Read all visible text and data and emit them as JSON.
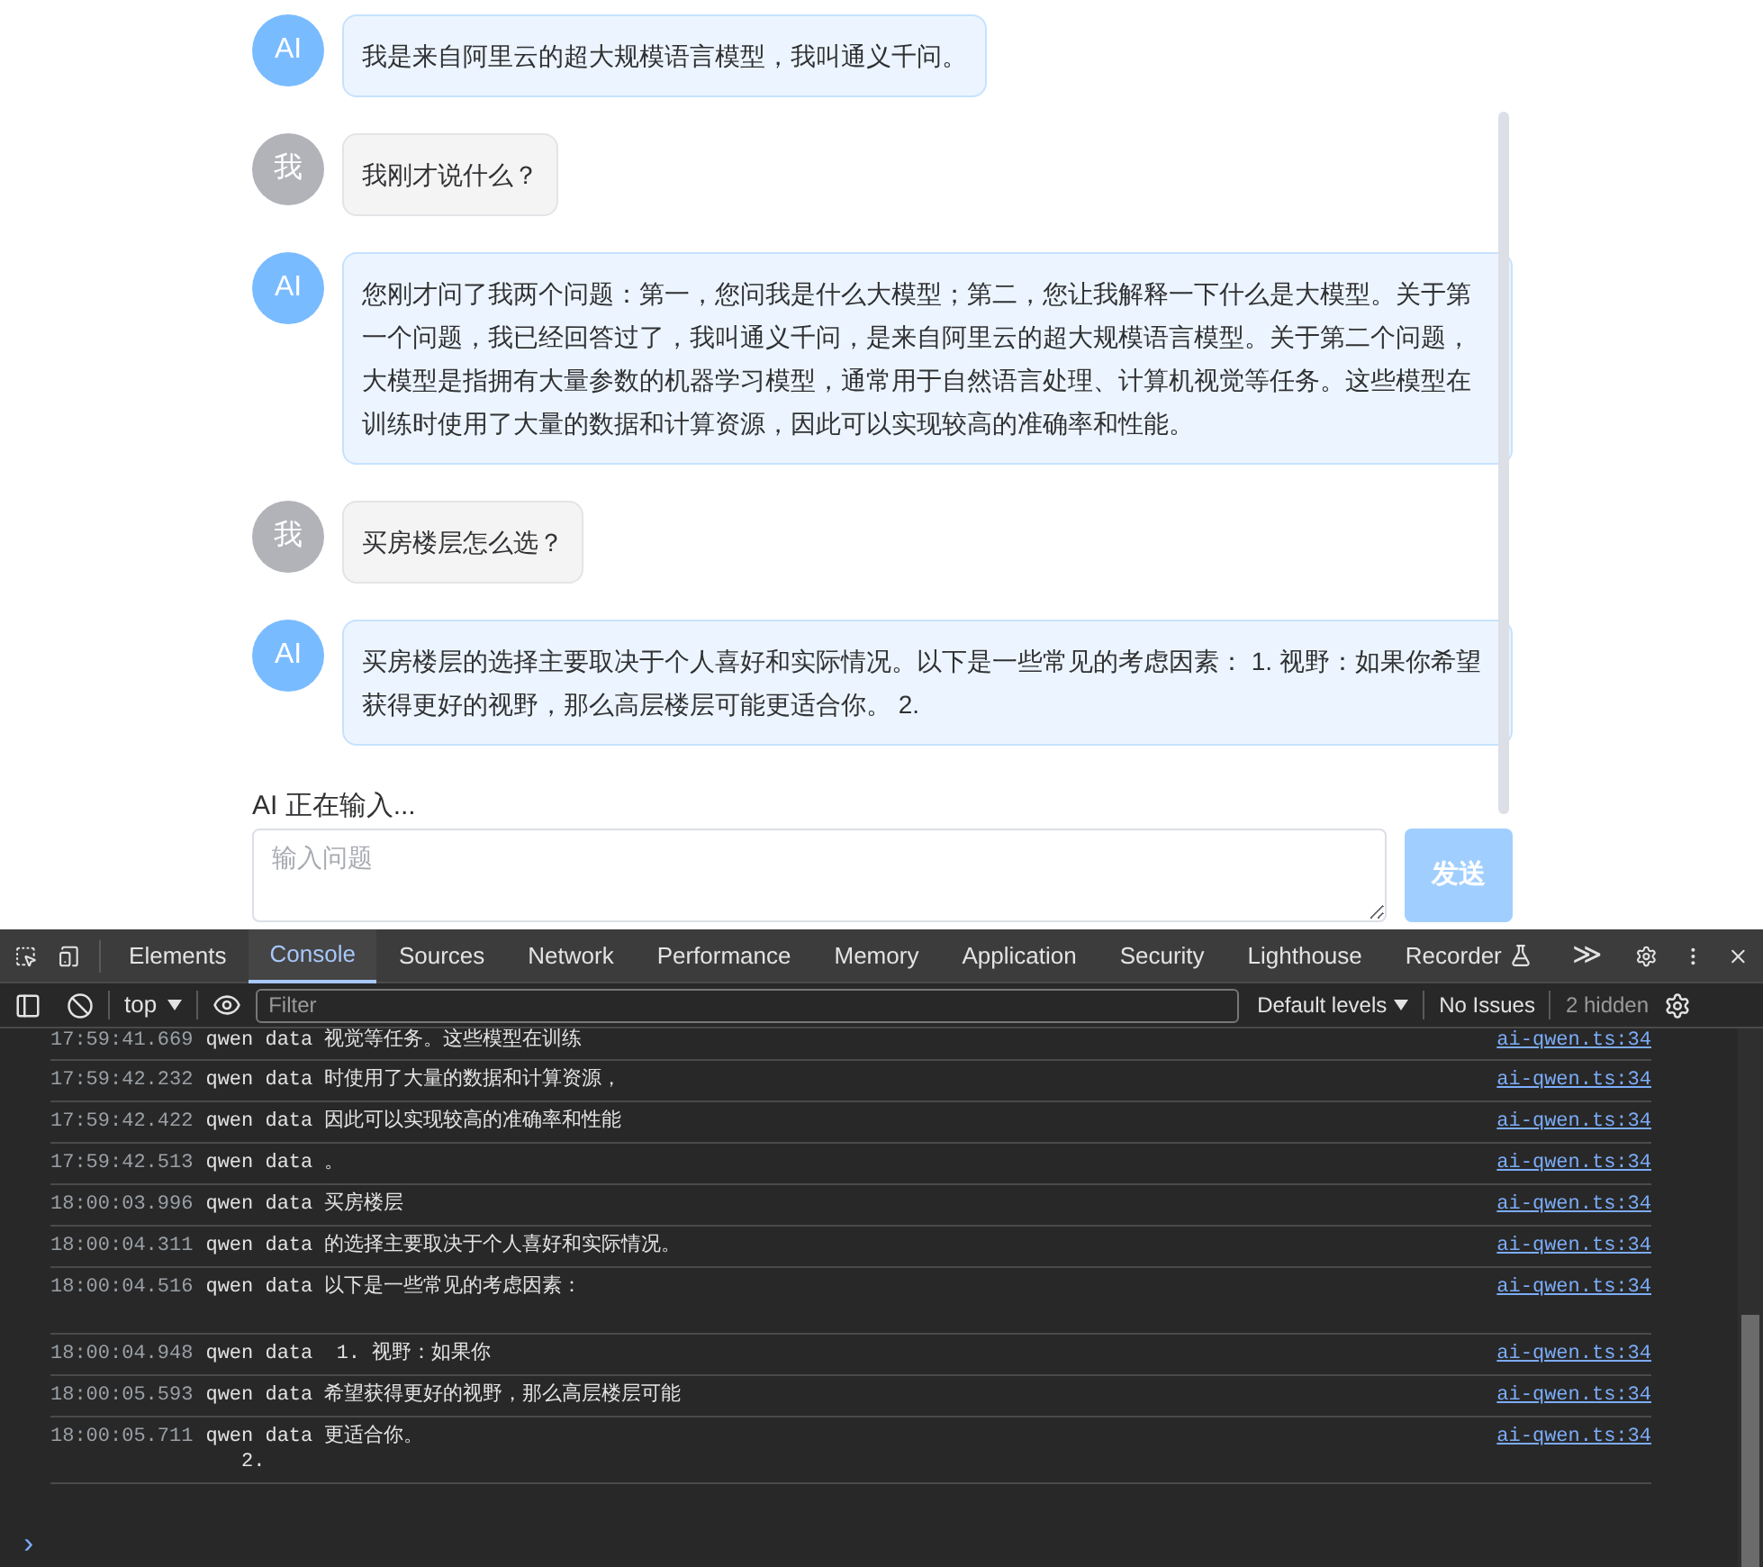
{
  "chat": {
    "messages": [
      {
        "kind": "ai",
        "avatar": "AI",
        "text": "我是来自阿里云的超大规模语言模型，我叫通义千问。"
      },
      {
        "kind": "user",
        "avatar": "我",
        "text": "我刚才说什么？"
      },
      {
        "kind": "ai",
        "avatar": "AI",
        "text": "您刚才问了我两个问题：第一，您问我是什么大模型；第二，您让我解释一下什么是大模型。关于第一个问题，我已经回答过了，我叫通义千问，是来自阿里云的超大规模语言模型。关于第二个问题，大模型是指拥有大量参数的机器学习模型，通常用于自然语言处理、计算机视觉等任务。这些模型在训练时使用了大量的数据和计算资源，因此可以实现较高的准确率和性能。"
      },
      {
        "kind": "user",
        "avatar": "我",
        "text": "买房楼层怎么选？"
      },
      {
        "kind": "ai",
        "avatar": "AI",
        "text": "买房楼层的选择主要取决于个人喜好和实际情况。以下是一些常见的考虑因素： 1. 视野：如果你希望获得更好的视野，那么高层楼层可能更适合你。 2."
      }
    ],
    "status": "AI 正在输入...",
    "input": {
      "placeholder": "输入问题"
    },
    "send_button": {
      "label": "发送",
      "disabled": true
    }
  },
  "devtools": {
    "tabs": [
      {
        "label": "Elements",
        "selected": false
      },
      {
        "label": "Console",
        "selected": true
      },
      {
        "label": "Sources",
        "selected": false
      },
      {
        "label": "Network",
        "selected": false
      },
      {
        "label": "Performance",
        "selected": false
      },
      {
        "label": "Memory",
        "selected": false
      },
      {
        "label": "Application",
        "selected": false
      },
      {
        "label": "Security",
        "selected": false
      },
      {
        "label": "Lighthouse",
        "selected": false
      },
      {
        "label": "Recorder",
        "selected": false
      }
    ],
    "more_tabs": "≫",
    "toolbar": {
      "context": "top",
      "filter_placeholder": "Filter",
      "levels": "Default levels",
      "issues": "No Issues",
      "hidden": "2 hidden"
    },
    "console_rows": [
      {
        "time": "17:59:41.669",
        "text": "qwen data 视觉等任务。这些模型在训练",
        "source": "ai-qwen.ts:34"
      },
      {
        "time": "17:59:42.232",
        "text": "qwen data 时使用了大量的数据和计算资源，",
        "source": "ai-qwen.ts:34"
      },
      {
        "time": "17:59:42.422",
        "text": "qwen data 因此可以实现较高的准确率和性能",
        "source": "ai-qwen.ts:34"
      },
      {
        "time": "17:59:42.513",
        "text": "qwen data 。",
        "source": "ai-qwen.ts:34"
      },
      {
        "time": "18:00:03.996",
        "text": "qwen data 买房楼层",
        "source": "ai-qwen.ts:34"
      },
      {
        "time": "18:00:04.311",
        "text": "qwen data 的选择主要取决于个人喜好和实际情况。",
        "source": "ai-qwen.ts:34"
      },
      {
        "time": "18:00:04.516",
        "text": "qwen data 以下是一些常见的考虑因素：\n\n",
        "source": "ai-qwen.ts:34"
      },
      {
        "time": "18:00:04.948",
        "text": "qwen data  1. 视野：如果你",
        "source": "ai-qwen.ts:34"
      },
      {
        "time": "18:00:05.593",
        "text": "qwen data 希望获得更好的视野，那么高层楼层可能",
        "source": "ai-qwen.ts:34"
      },
      {
        "time": "18:00:05.711",
        "text": "qwen data 更适合你。\n   2.",
        "source": "ai-qwen.ts:34"
      }
    ],
    "prompt": "›"
  }
}
